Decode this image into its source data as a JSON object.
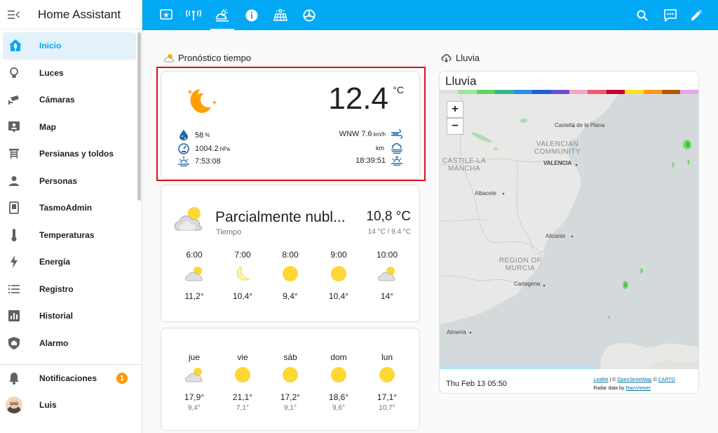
{
  "sidebar": {
    "title": "Home Assistant",
    "items": [
      {
        "label": "Inicio",
        "icon": "home-icon",
        "active": true
      },
      {
        "label": "Luces",
        "icon": "lightbulb-icon"
      },
      {
        "label": "Cámaras",
        "icon": "cctv-icon"
      },
      {
        "label": "Map",
        "icon": "map-icon"
      },
      {
        "label": "Persianas y toldos",
        "icon": "blinds-icon"
      },
      {
        "label": "Personas",
        "icon": "person-icon"
      },
      {
        "label": "TasmoAdmin",
        "icon": "tablet-icon"
      },
      {
        "label": "Temperaturas",
        "icon": "thermometer-icon"
      },
      {
        "label": "Energía",
        "icon": "flash-icon"
      },
      {
        "label": "Registro",
        "icon": "list-icon"
      },
      {
        "label": "Historial",
        "icon": "chart-icon"
      },
      {
        "label": "Alarmo",
        "icon": "shield-icon"
      }
    ],
    "notifications": {
      "label": "Notificaciones",
      "count": "1"
    },
    "user": {
      "label": "Luis"
    }
  },
  "topbar": {
    "tabs": [
      "dashboard-icon",
      "antenna-icon",
      "weather-icon",
      "info-icon",
      "solar-icon",
      "steering-icon"
    ],
    "active_tab": 2,
    "tools": [
      "search-icon",
      "assist-icon",
      "edit-icon"
    ]
  },
  "forecast_section": {
    "title": "Pronóstico tiempo"
  },
  "rain_section": {
    "title": "Lluvia"
  },
  "weather_card": {
    "temperature": "12.4",
    "unit": "°C",
    "humidity": "58",
    "humidity_unit": "%",
    "pressure": "1004.2",
    "pressure_unit": "hPa",
    "sunrise": "7:53:08",
    "wind": "WNW 7.6",
    "wind_unit": "km/h",
    "visibility_unit": "km",
    "sunset": "18:39:51"
  },
  "condition_card": {
    "condition": "Parcialmente nubl...",
    "subtitle": "Tiempo",
    "temperature": "10,8 °C",
    "range": "14 °C / 9,4 °C",
    "hourly": [
      {
        "time": "6:00",
        "icon": "partly-cloudy-icon",
        "temp": "11,2°"
      },
      {
        "time": "7:00",
        "icon": "moon-icon",
        "temp": "10,4°"
      },
      {
        "time": "8:00",
        "icon": "sun-icon",
        "temp": "9,4°"
      },
      {
        "time": "9:00",
        "icon": "sun-icon",
        "temp": "10,4°"
      },
      {
        "time": "10:00",
        "icon": "partly-cloudy-icon",
        "temp": "14°"
      }
    ]
  },
  "daily_card": {
    "days": [
      {
        "day": "jue",
        "icon": "partly-cloudy-icon",
        "high": "17,9°",
        "low": "9,4°"
      },
      {
        "day": "vie",
        "icon": "sun-icon",
        "high": "21,1°",
        "low": "7,1°"
      },
      {
        "day": "sáb",
        "icon": "sun-icon",
        "high": "17,2°",
        "low": "9,1°"
      },
      {
        "day": "dom",
        "icon": "sun-icon",
        "high": "18,6°",
        "low": "9,6°"
      },
      {
        "day": "lun",
        "icon": "sun-icon",
        "high": "17,1°",
        "low": "10,7°"
      }
    ]
  },
  "map_card": {
    "title": "Lluvia",
    "legend_colors": [
      "#dfdfdf",
      "#9be89b",
      "#5fd45f",
      "#33b58a",
      "#2b8fe3",
      "#1f5fd1",
      "#6a4fc9",
      "#f4a6c1",
      "#ef5a6f",
      "#c2002f",
      "#ffe21a",
      "#ff9a1a",
      "#b35a00",
      "#e3a6f2"
    ],
    "zoom_in": "+",
    "zoom_out": "−",
    "labels": {
      "castellon": "Castelló de la Plana",
      "valencian": "VALENCIAN COMMUNITY",
      "valencia": "VALENCIA",
      "castile": "CASTILE-LA MANCHA",
      "albacete": "Albacete",
      "alicante": "Alicante",
      "murcia_region": "REGION OF MURCIA",
      "cartagena": "Cartagena",
      "almeria": "Almería"
    },
    "timestamp": "Thu Feb 13 05:50",
    "attribution_leaflet": "Leaflet",
    "attribution_mid": " | © ",
    "attribution_osm": "OpenStreetMap",
    "attribution_sep": " © ",
    "attribution_carto": "CARTO",
    "attribution_radar": "Radar data by ",
    "attribution_rv": "RainViewer"
  }
}
